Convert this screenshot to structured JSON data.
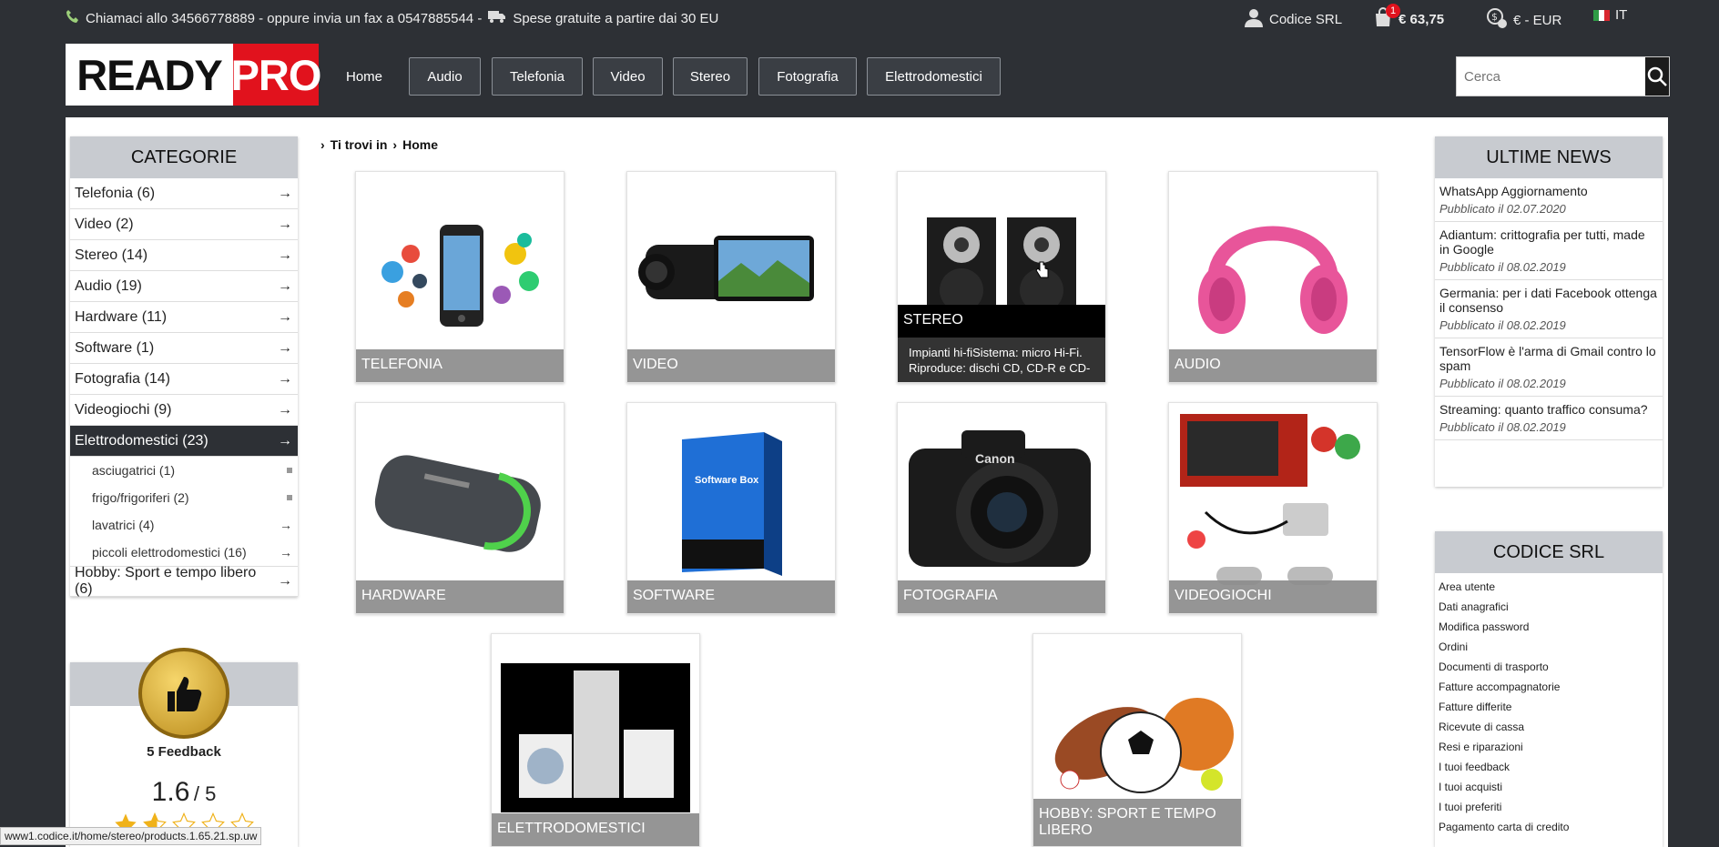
{
  "topbar": {
    "contact": "Chiamaci allo 34566778889 - oppure invia un fax a 0547885544 -",
    "shipping": "Spese gratuite a partire dai 30 EU",
    "account": "Codice SRL",
    "cart_count": "1",
    "cart_total": "€ 63,75",
    "currency": "€ - EUR",
    "language": "IT"
  },
  "logo": {
    "ready": "READY",
    "pro": "PRO"
  },
  "nav": {
    "home": "Home",
    "items": [
      "Audio",
      "Telefonia",
      "Video",
      "Stereo",
      "Fotografia",
      "Elettrodomestici"
    ]
  },
  "search": {
    "placeholder": "Cerca"
  },
  "breadcrumb": {
    "prefix": "Ti trovi in",
    "current": "Home"
  },
  "categories": {
    "title": "CATEGORIE",
    "items": [
      "Telefonia (6)",
      "Video (2)",
      "Stereo (14)",
      "Audio (19)",
      "Hardware (11)",
      "Software (1)",
      "Fotografia (14)",
      "Videogiochi (9)",
      "Elettrodomestici (23)"
    ],
    "sub_items": [
      "asciugatrici (1)",
      "frigo/frigoriferi (2)",
      "lavatrici (4)",
      "piccoli elettrodomestici (16)"
    ],
    "last_item": "Hobby: Sport e tempo libero (6)"
  },
  "feedback": {
    "label": "5 Feedback",
    "score": "1.6",
    "max": "/ 5",
    "rating_fraction": 0.32
  },
  "tiles": [
    {
      "label": "TELEFONIA"
    },
    {
      "label": "VIDEO"
    },
    {
      "label": "STEREO",
      "desc": "Impianti hi-fiSistema: micro Hi-Fi. Riproduce: dischi CD, CD-R e CD-"
    },
    {
      "label": "AUDIO"
    },
    {
      "label": "HARDWARE"
    },
    {
      "label": "SOFTWARE"
    },
    {
      "label": "FOTOGRAFIA"
    },
    {
      "label": "VIDEOGIOCHI"
    },
    {
      "label": "ELETTRODOMESTICI"
    },
    {
      "label": "HOBBY: SPORT E TEMPO LIBERO"
    }
  ],
  "software_box_text": "Software Box",
  "camera_brand": "Canon",
  "news": {
    "title": "ULTIME NEWS",
    "items": [
      {
        "title": "WhatsApp Aggiornamento",
        "date": "Pubblicato il 02.07.2020"
      },
      {
        "title": "Adiantum: crittografia per tutti, made in Google",
        "date": "Pubblicato il 08.02.2019"
      },
      {
        "title": "Germania: per i dati Facebook ottenga il consenso",
        "date": "Pubblicato il 08.02.2019"
      },
      {
        "title": "TensorFlow è l'arma di Gmail contro lo spam",
        "date": "Pubblicato il 08.02.2019"
      },
      {
        "title": "Streaming: quanto traffico consuma?",
        "date": "Pubblicato il 08.02.2019"
      }
    ]
  },
  "account": {
    "title": "CODICE SRL",
    "links": [
      "Area utente",
      "Dati anagrafici",
      "Modifica password",
      "Ordini",
      "Documenti di trasporto",
      "Fatture accompagnatorie",
      "Fatture differite",
      "Ricevute di cassa",
      "Resi e riparazioni",
      "I tuoi feedback",
      "I tuoi acquisti",
      "I tuoi preferiti",
      "Pagamento carta di credito"
    ]
  },
  "status_url": "www1.codice.it/home/stereo/products.1.65.21.sp.uw",
  "colors": {
    "brand_red": "#e1121d",
    "dark": "#2d3035",
    "panel_head": "#c8cbd0"
  }
}
